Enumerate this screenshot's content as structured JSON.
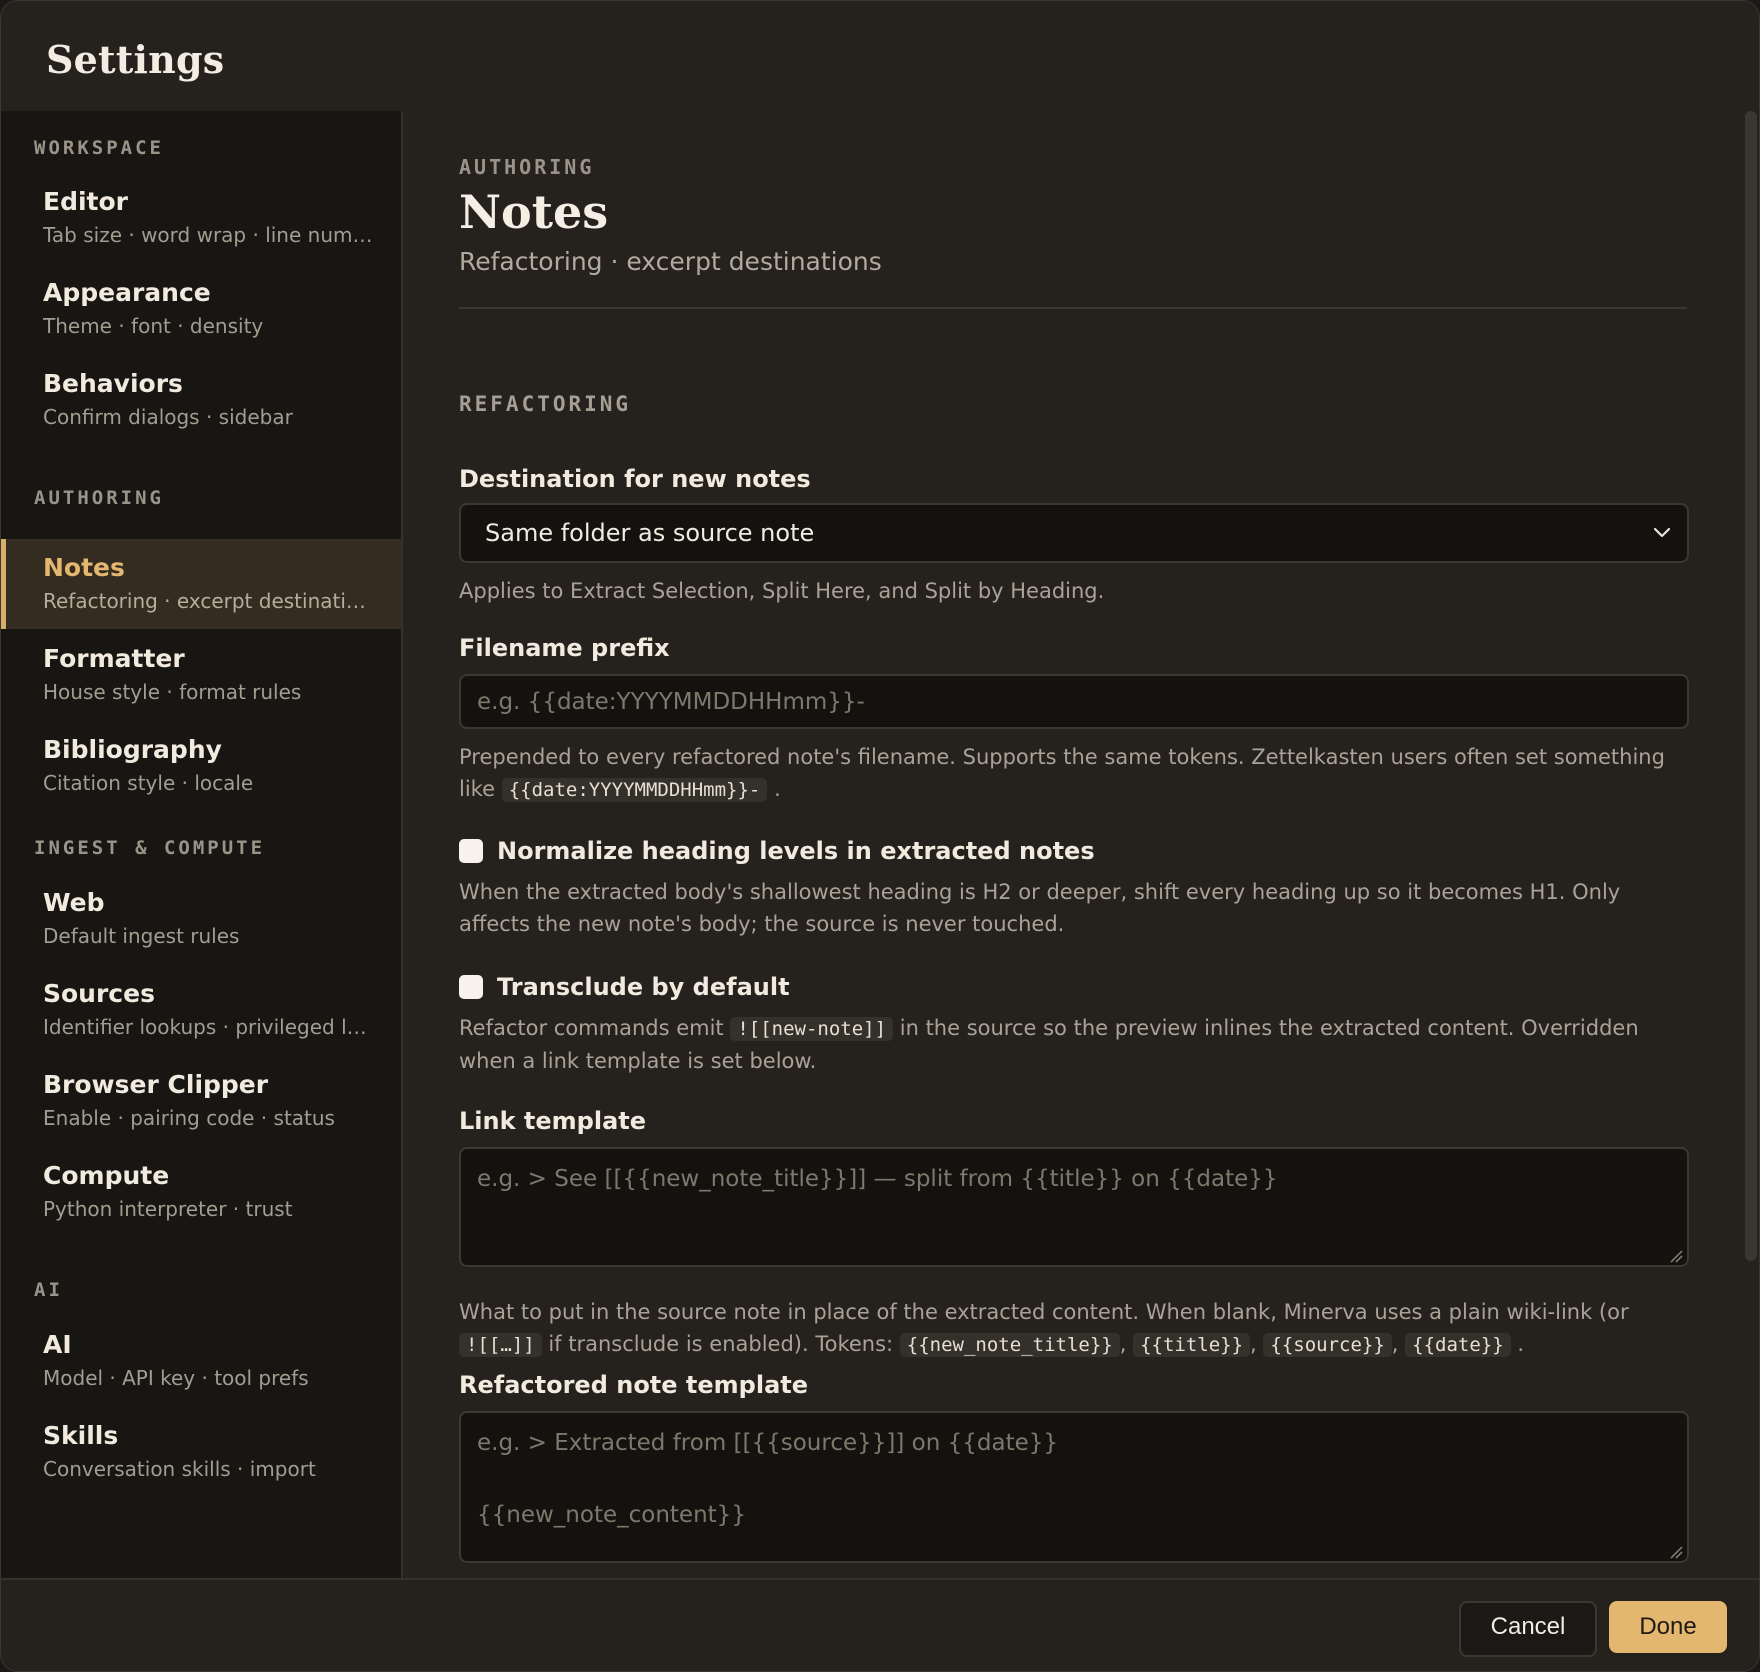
{
  "window": {
    "title": "Settings"
  },
  "sidebar": {
    "groups": [
      {
        "label": "WORKSPACE",
        "items": [
          {
            "title": "Editor",
            "subtitle": "Tab size · word wrap · line numb..."
          },
          {
            "title": "Appearance",
            "subtitle": "Theme · font · density"
          },
          {
            "title": "Behaviors",
            "subtitle": "Confirm dialogs · sidebar"
          }
        ]
      },
      {
        "label": "AUTHORING",
        "items": [
          {
            "title": "Notes",
            "subtitle": "Refactoring · excerpt destinations",
            "active": true
          },
          {
            "title": "Formatter",
            "subtitle": "House style · format rules"
          },
          {
            "title": "Bibliography",
            "subtitle": "Citation style · locale"
          }
        ]
      },
      {
        "label": "INGEST & COMPUTE",
        "items": [
          {
            "title": "Web",
            "subtitle": "Default ingest rules"
          },
          {
            "title": "Sources",
            "subtitle": "Identifier lookups · privileged lo..."
          },
          {
            "title": "Browser Clipper",
            "subtitle": "Enable · pairing code · status"
          },
          {
            "title": "Compute",
            "subtitle": "Python interpreter · trust"
          }
        ]
      },
      {
        "label": "AI",
        "items": [
          {
            "title": "AI",
            "subtitle": "Model · API key · tool prefs"
          },
          {
            "title": "Skills",
            "subtitle": "Conversation skills · import"
          }
        ]
      }
    ]
  },
  "main": {
    "eyebrow": "AUTHORING",
    "title": "Notes",
    "subtitle": "Refactoring · excerpt destinations",
    "section": "REFACTORING",
    "destination": {
      "label": "Destination for new notes",
      "value": "Same folder as source note",
      "help": "Applies to Extract Selection, Split Here, and Split by Heading."
    },
    "filename_prefix": {
      "label": "Filename prefix",
      "placeholder": "e.g. {{date:YYYYMMDDHHmm}}-",
      "help": "Prepended to every refactored note's filename. Supports the same tokens. Zettelkasten users often set something like",
      "help_code": "{{date:YYYYMMDDHHmm}}-",
      "help_end": "."
    },
    "normalize": {
      "label": "Normalize heading levels in extracted notes",
      "checked": false,
      "help": "When the extracted body's shallowest heading is H2 or deeper, shift every heading up so it becomes H1. Only affects the new note's body; the source is never touched."
    },
    "transclude": {
      "label": "Transclude by default",
      "checked": false,
      "help_a": "Refactor commands emit",
      "help_code": "![[new-note]]",
      "help_b": "in the source so the preview inlines the extracted content. Overridden when a link template is set below."
    },
    "link_template": {
      "label": "Link template",
      "placeholder": "e.g. > See [[{{new_note_title}}]] — split from {{title}} on {{date}}",
      "help_a": "What to put in the source note in place of the extracted content. When blank, Minerva uses a plain wiki-link (or",
      "code_a": "![[…]]",
      "help_b": "if transclude is enabled). Tokens:",
      "tokens": [
        "{{new_note_title}}",
        "{{title}}",
        "{{source}}",
        "{{date}}"
      ],
      "sep": ",",
      "end": "."
    },
    "note_template": {
      "label": "Refactored note template",
      "placeholder": "e.g. > Extracted from [[{{source}}]] on {{date}}\n\n{{new_note_content}}"
    }
  },
  "footer": {
    "cancel": "Cancel",
    "done": "Done"
  },
  "colors": {
    "accent": "#e3b770",
    "background": "#25221e",
    "sidebar": "#181613"
  }
}
